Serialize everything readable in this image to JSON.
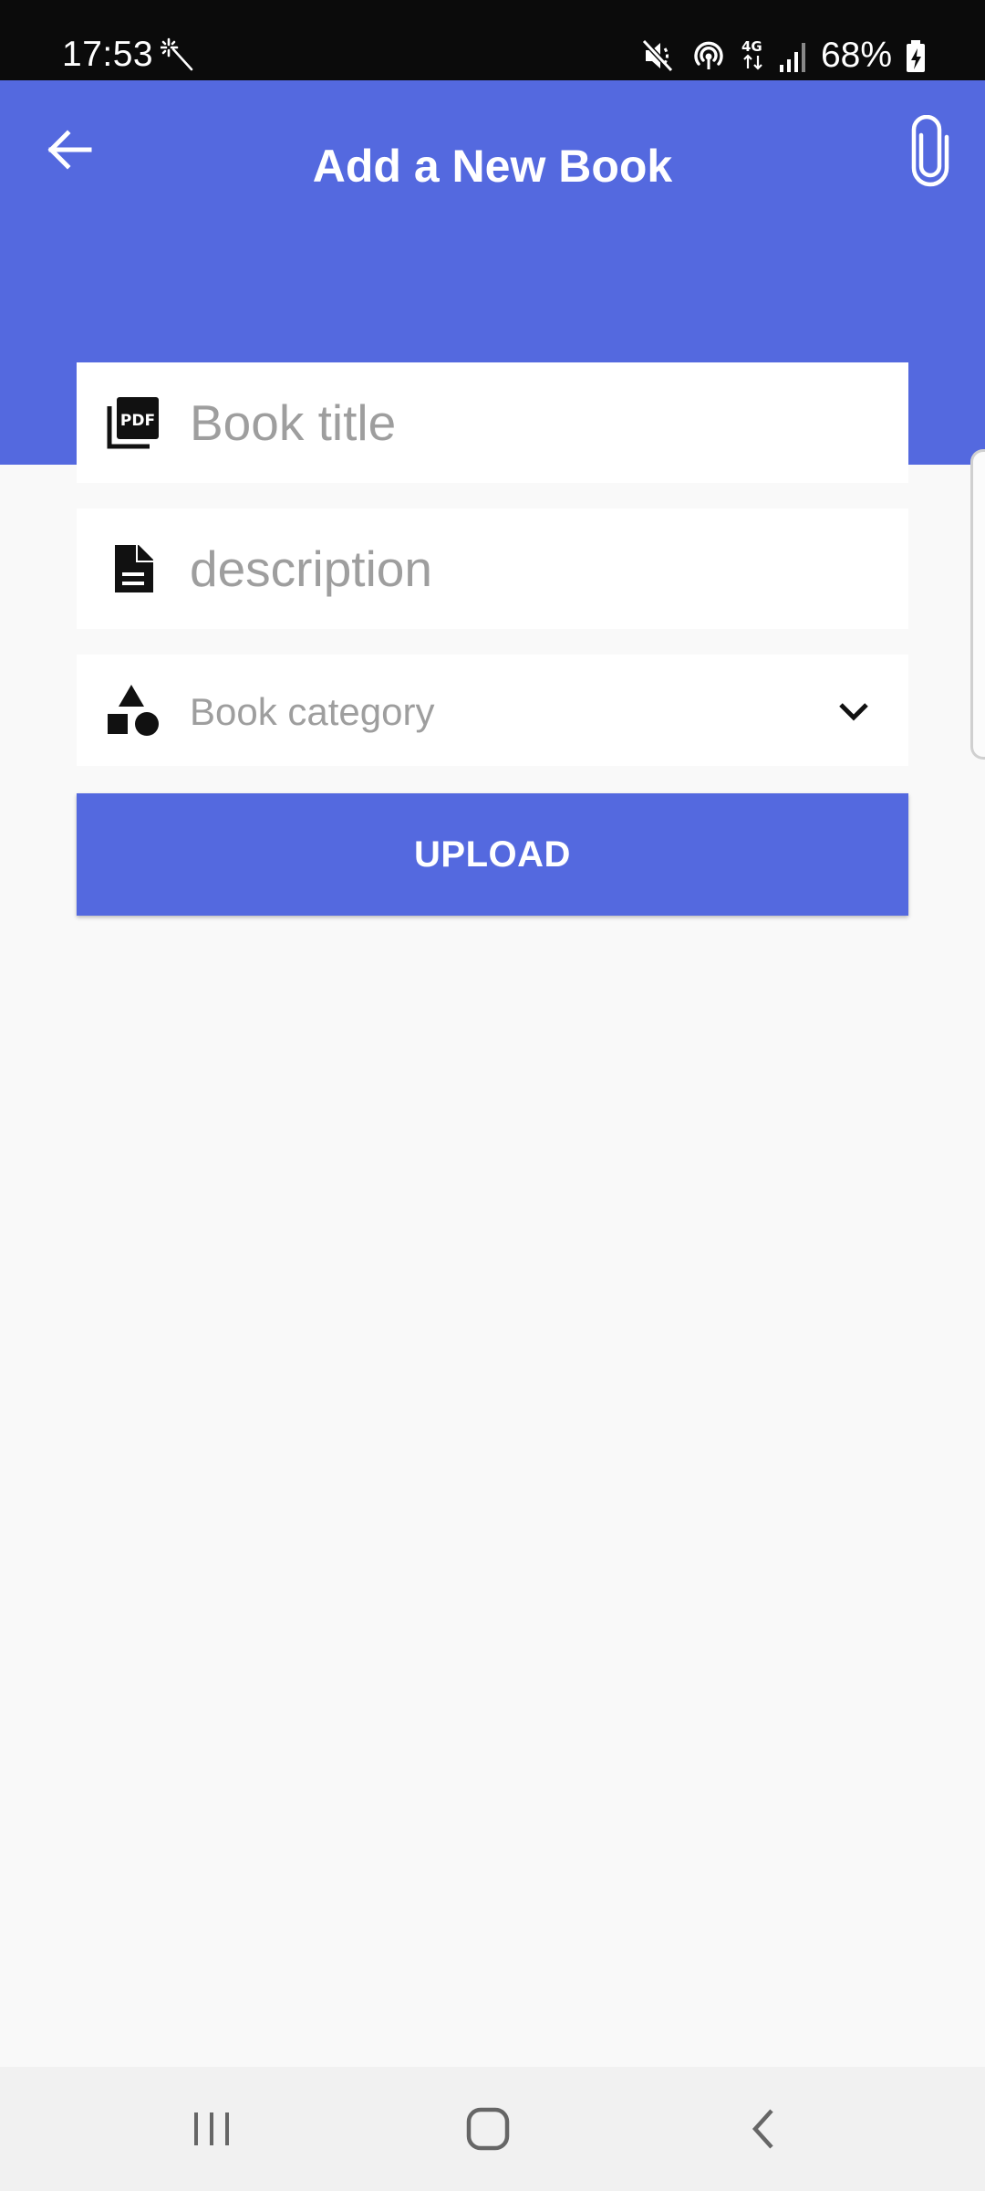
{
  "status_bar": {
    "time": "17:53",
    "battery": "68%",
    "icons": [
      "magic-wand-icon",
      "mute-icon",
      "hotspot-icon",
      "4g-icon",
      "signal-icon",
      "battery-charging-icon"
    ]
  },
  "app_bar": {
    "title": "Add a New Book",
    "back_icon": "arrow-back-icon",
    "attach_icon": "paperclip-icon",
    "color": "#5469df"
  },
  "form": {
    "title_field": {
      "placeholder": "Book title",
      "icon": "pdf-icon"
    },
    "description_field": {
      "placeholder": "description",
      "icon": "document-icon"
    },
    "category_field": {
      "placeholder": "Book category",
      "icon": "shapes-icon",
      "dropdown_icon": "chevron-down-icon"
    },
    "upload_button": {
      "label": "UPLOAD",
      "color": "#5469df"
    }
  },
  "nav_bar": {
    "icons": [
      "recents-icon",
      "home-icon",
      "back-icon"
    ]
  }
}
